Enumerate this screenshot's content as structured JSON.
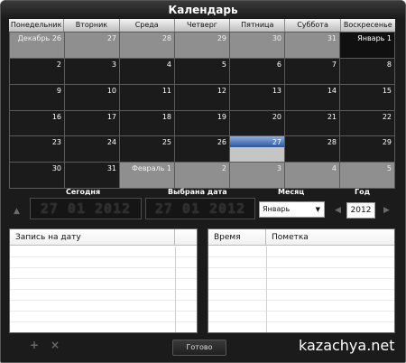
{
  "window": {
    "title": "Календарь"
  },
  "calendar": {
    "weekdays": [
      "Понедельник",
      "Вторник",
      "Среда",
      "Четверг",
      "Пятница",
      "Суббота",
      "Воскресенье"
    ],
    "weeks": [
      [
        {
          "label": "Декабрь 26",
          "kind": "other"
        },
        {
          "label": "27",
          "kind": "other"
        },
        {
          "label": "28",
          "kind": "other"
        },
        {
          "label": "29",
          "kind": "other"
        },
        {
          "label": "30",
          "kind": "other"
        },
        {
          "label": "31",
          "kind": "other"
        },
        {
          "label": "Январь 1",
          "kind": "current"
        }
      ],
      [
        {
          "label": "2",
          "kind": "current"
        },
        {
          "label": "3",
          "kind": "current"
        },
        {
          "label": "4",
          "kind": "current"
        },
        {
          "label": "5",
          "kind": "current"
        },
        {
          "label": "6",
          "kind": "current"
        },
        {
          "label": "7",
          "kind": "current"
        },
        {
          "label": "8",
          "kind": "current"
        }
      ],
      [
        {
          "label": "9",
          "kind": "current"
        },
        {
          "label": "10",
          "kind": "current"
        },
        {
          "label": "11",
          "kind": "current"
        },
        {
          "label": "12",
          "kind": "current"
        },
        {
          "label": "13",
          "kind": "current"
        },
        {
          "label": "14",
          "kind": "current"
        },
        {
          "label": "15",
          "kind": "current"
        }
      ],
      [
        {
          "label": "16",
          "kind": "current"
        },
        {
          "label": "17",
          "kind": "current"
        },
        {
          "label": "18",
          "kind": "current"
        },
        {
          "label": "19",
          "kind": "current"
        },
        {
          "label": "20",
          "kind": "current"
        },
        {
          "label": "21",
          "kind": "current"
        },
        {
          "label": "22",
          "kind": "current"
        }
      ],
      [
        {
          "label": "23",
          "kind": "current"
        },
        {
          "label": "24",
          "kind": "current"
        },
        {
          "label": "25",
          "kind": "current"
        },
        {
          "label": "26",
          "kind": "current"
        },
        {
          "label": "27",
          "kind": "selected"
        },
        {
          "label": "28",
          "kind": "current"
        },
        {
          "label": "29",
          "kind": "current"
        }
      ],
      [
        {
          "label": "30",
          "kind": "current"
        },
        {
          "label": "31",
          "kind": "current"
        },
        {
          "label": "Февраль 1",
          "kind": "other"
        },
        {
          "label": "2",
          "kind": "other"
        },
        {
          "label": "3",
          "kind": "other"
        },
        {
          "label": "4",
          "kind": "other"
        },
        {
          "label": "5",
          "kind": "other"
        }
      ]
    ]
  },
  "controls": {
    "today_label": "Сегодня",
    "today_value": "27 01 2012",
    "selected_label": "Выбрана дата",
    "selected_value": "27 01 2012",
    "month_label": "Месяц",
    "month_value": "Январь",
    "year_label": "Год",
    "year_value": "2012"
  },
  "left_panel": {
    "header": "Запись на дату"
  },
  "right_panel": {
    "col_time": "Время",
    "col_note": "Пометка"
  },
  "footer": {
    "add_symbol": "+",
    "delete_symbol": "×",
    "ok_label": "Готово",
    "watermark": "kazachya.net"
  }
}
